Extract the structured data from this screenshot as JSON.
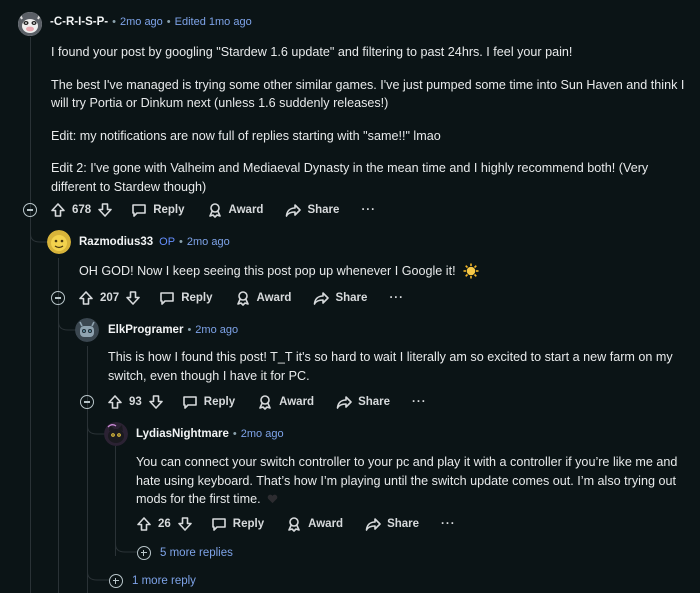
{
  "comments": [
    {
      "username": "-C-R-I-S-P-",
      "op": "",
      "time": "2mo ago",
      "edited": "Edited 1mo ago",
      "paragraphs": [
        "I found your post by googling \"Stardew 1.6 update\" and filtering to past 24hrs. I feel your pain!",
        "The best I've managed is trying some other similar games. I've just pumped some time into Sun Haven and think I will try Portia or Dinkum next (unless 1.6 suddenly releases!)",
        "Edit: my notifications are now full of replies starting with \"same!!\" lmao",
        "Edit 2: I've gone with Valheim and Mediaeval Dynasty in the mean time and I highly recommend both! (Very different to Stardew though)"
      ],
      "votes": "678"
    },
    {
      "username": "Razmodius33",
      "op": "OP",
      "time": "2mo ago",
      "paragraphs": [
        "OH GOD! Now I keep seeing this post pop up whenever I Google it!"
      ],
      "votes": "207"
    },
    {
      "username": "ElkProgramer",
      "time": "2mo ago",
      "paragraphs": [
        "This is how I found this post! T_T it's so hard to wait I literally am so excited to start a new farm on my switch, even though I have it for PC."
      ],
      "votes": "93"
    },
    {
      "username": "LydiasNightmare",
      "time": "2mo ago",
      "paragraphs": [
        "You can connect your switch controller to your pc and play it with a controller if you’re like me and hate using keyboard. That’s how I’m playing until the switch update comes out. I’m also trying out mods for the first time."
      ],
      "votes": "26"
    }
  ],
  "actions": {
    "reply": "Reply",
    "award": "Award",
    "share": "Share",
    "more": "···"
  },
  "more_replies": {
    "level4": "5 more replies",
    "level2": "1 more reply"
  },
  "colors": {
    "background": "#0b1416",
    "link": "#7ea3e8",
    "op": "#648efc"
  },
  "icons": [
    "upvote-icon",
    "downvote-icon",
    "reply-icon",
    "award-icon",
    "share-icon",
    "collapse-icon",
    "expand-icon",
    "sun-emoji-icon",
    "heart-icon"
  ]
}
